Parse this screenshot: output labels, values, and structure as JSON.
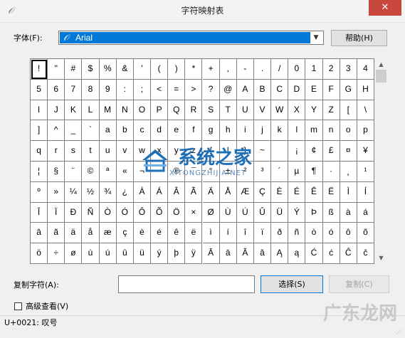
{
  "window": {
    "title": "字符映射表",
    "close_glyph": "✕"
  },
  "font": {
    "label": "字体(F):",
    "icon_glyph": "𝒪",
    "selected": "Arial",
    "help_label": "帮助(H)"
  },
  "grid": {
    "selected_char": "!",
    "chars": [
      "!",
      "\"",
      "#",
      "$",
      "%",
      "&",
      "'",
      "(",
      ")",
      "*",
      "+",
      ",",
      "-",
      ".",
      "/",
      "0",
      "1",
      "2",
      "3",
      "4",
      "5",
      "6",
      "7",
      "8",
      "9",
      ":",
      ";",
      "<",
      "=",
      ">",
      "?",
      "@",
      "A",
      "B",
      "C",
      "D",
      "E",
      "F",
      "G",
      "H",
      "I",
      "J",
      "K",
      "L",
      "M",
      "N",
      "O",
      "P",
      "Q",
      "R",
      "S",
      "T",
      "U",
      "V",
      "W",
      "X",
      "Y",
      "Z",
      "[",
      "\\",
      "]",
      "^",
      "_",
      "`",
      "a",
      "b",
      "c",
      "d",
      "e",
      "f",
      "g",
      "h",
      "i",
      "j",
      "k",
      "l",
      "m",
      "n",
      "o",
      "p",
      "q",
      "r",
      "s",
      "t",
      "u",
      "v",
      "w",
      "x",
      "y",
      "z",
      "{",
      "|",
      "}",
      "~",
      " ",
      "¡",
      "¢",
      "£",
      "¤",
      "¥",
      "¦",
      "§",
      "¨",
      "©",
      "ª",
      "«",
      "¬",
      "",
      "®",
      "¯",
      "°",
      "±",
      "²",
      "³",
      "´",
      "µ",
      "¶",
      "·",
      "¸",
      "¹",
      "º",
      "»",
      "¼",
      "½",
      "¾",
      "¿",
      "À",
      "Á",
      "Â",
      "Ã",
      "Ä",
      "Å",
      "Æ",
      "Ç",
      "È",
      "É",
      "Ê",
      "Ë",
      "Ì",
      "Í",
      "Î",
      "Ï",
      "Ð",
      "Ñ",
      "Ò",
      "Ó",
      "Ô",
      "Õ",
      "Ö",
      "×",
      "Ø",
      "Ù",
      "Ú",
      "Û",
      "Ü",
      "Ý",
      "Þ",
      "ß",
      "à",
      "á",
      "â",
      "ã",
      "ä",
      "å",
      "æ",
      "ç",
      "è",
      "é",
      "ê",
      "ë",
      "ì",
      "í",
      "î",
      "ï",
      "ð",
      "ñ",
      "ò",
      "ó",
      "ô",
      "õ",
      "ö",
      "÷",
      "ø",
      "ù",
      "ú",
      "û",
      "ü",
      "ý",
      "þ",
      "ÿ",
      "Ā",
      "ā",
      "Ă",
      "ă",
      "Ą",
      "ą",
      "Ć",
      "ć",
      "Ĉ",
      "ĉ"
    ]
  },
  "copy": {
    "label": "复制字符(A):",
    "value": "",
    "select_label": "选择(S)",
    "copy_label": "复制(C)"
  },
  "advanced": {
    "label": "高级查看(V)",
    "checked": false
  },
  "status": {
    "text": "U+0021: 叹号"
  },
  "watermarks": {
    "site_cn": "系统之家",
    "site_en": "XITONGZHIJIA.NET",
    "corner": "广东龙网"
  },
  "colors": {
    "selection": "#0078d7",
    "close": "#c7473d",
    "watermark": "#1e6fb8"
  }
}
